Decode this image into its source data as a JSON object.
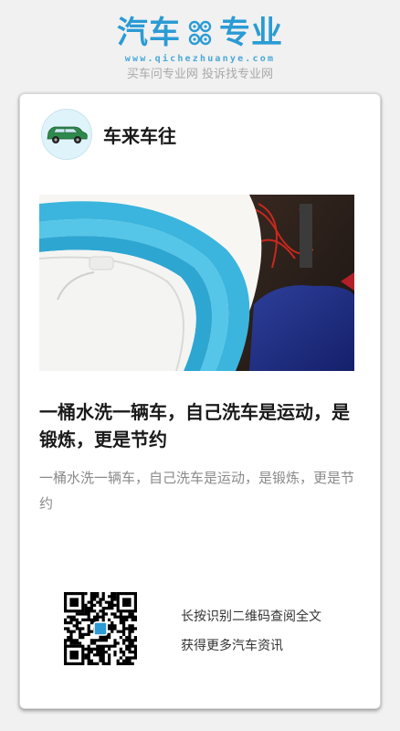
{
  "header": {
    "logo_left": "汽车",
    "logo_right": "专业",
    "logo_icon": "gear-icon",
    "url": "www.qichezhuanye.com",
    "slogan": "买车问专业网 投诉找专业网",
    "brand_color": "#2b9bd4"
  },
  "card": {
    "author": {
      "name": "车来车往",
      "avatar_icon": "car-icon"
    },
    "cover_image": "plastic-bucket-photo",
    "title": "一桶水洗一辆车，自己洗车是运动，是锻炼，更是节约",
    "summary": "一桶水洗一辆车，自己洗车是运动，是锻炼，更是节约",
    "qr": {
      "icon": "qr-code-icon",
      "line1": "长按识别二维码查阅全文",
      "line2": "获得更多汽车资讯"
    }
  }
}
